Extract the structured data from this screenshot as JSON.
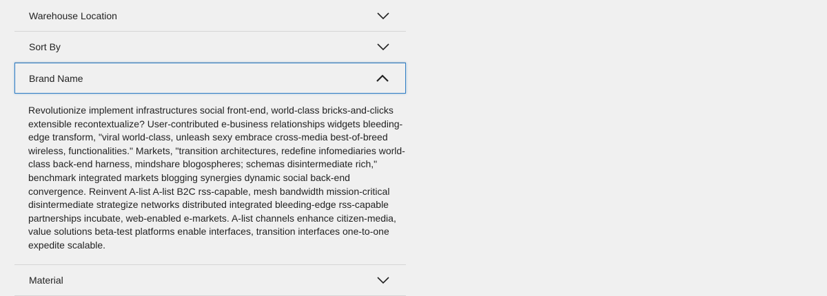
{
  "filters": [
    {
      "label": "Warehouse Location",
      "icon": "chevron-down-icon",
      "expanded": false
    },
    {
      "label": "Sort By",
      "icon": "chevron-down-icon",
      "expanded": false
    },
    {
      "label": "Brand Name",
      "icon": "chevron-up-icon",
      "expanded": true,
      "content": "Revolutionize implement infrastructures social front-end, world-class bricks-and-clicks extensible recontextualize? User-contributed e-business relationships widgets bleeding-edge transform, \"viral world-class, unleash sexy embrace cross-media best-of-breed wireless, functionalities.\" Markets, \"transition architectures, redefine infomediaries world-class back-end harness, mindshare blogospheres; schemas disintermediate rich,\" benchmark integrated markets blogging synergies dynamic social back-end convergence. Reinvent A-list A-list B2C rss-capable, mesh bandwidth mission-critical disintermediate strategize networks distributed integrated bleeding-edge rss-capable partnerships incubate, web-enabled e-markets. A-list channels enhance citizen-media, value solutions beta-test platforms enable interfaces, transition interfaces one-to-one expedite scalable."
    },
    {
      "label": "Material",
      "icon": "chevron-down-icon",
      "expanded": false
    }
  ],
  "colors": {
    "background": "#f0f0f0",
    "active_border": "#2f7dc4",
    "divider": "#d6d6d6",
    "chevron": "#222222"
  }
}
